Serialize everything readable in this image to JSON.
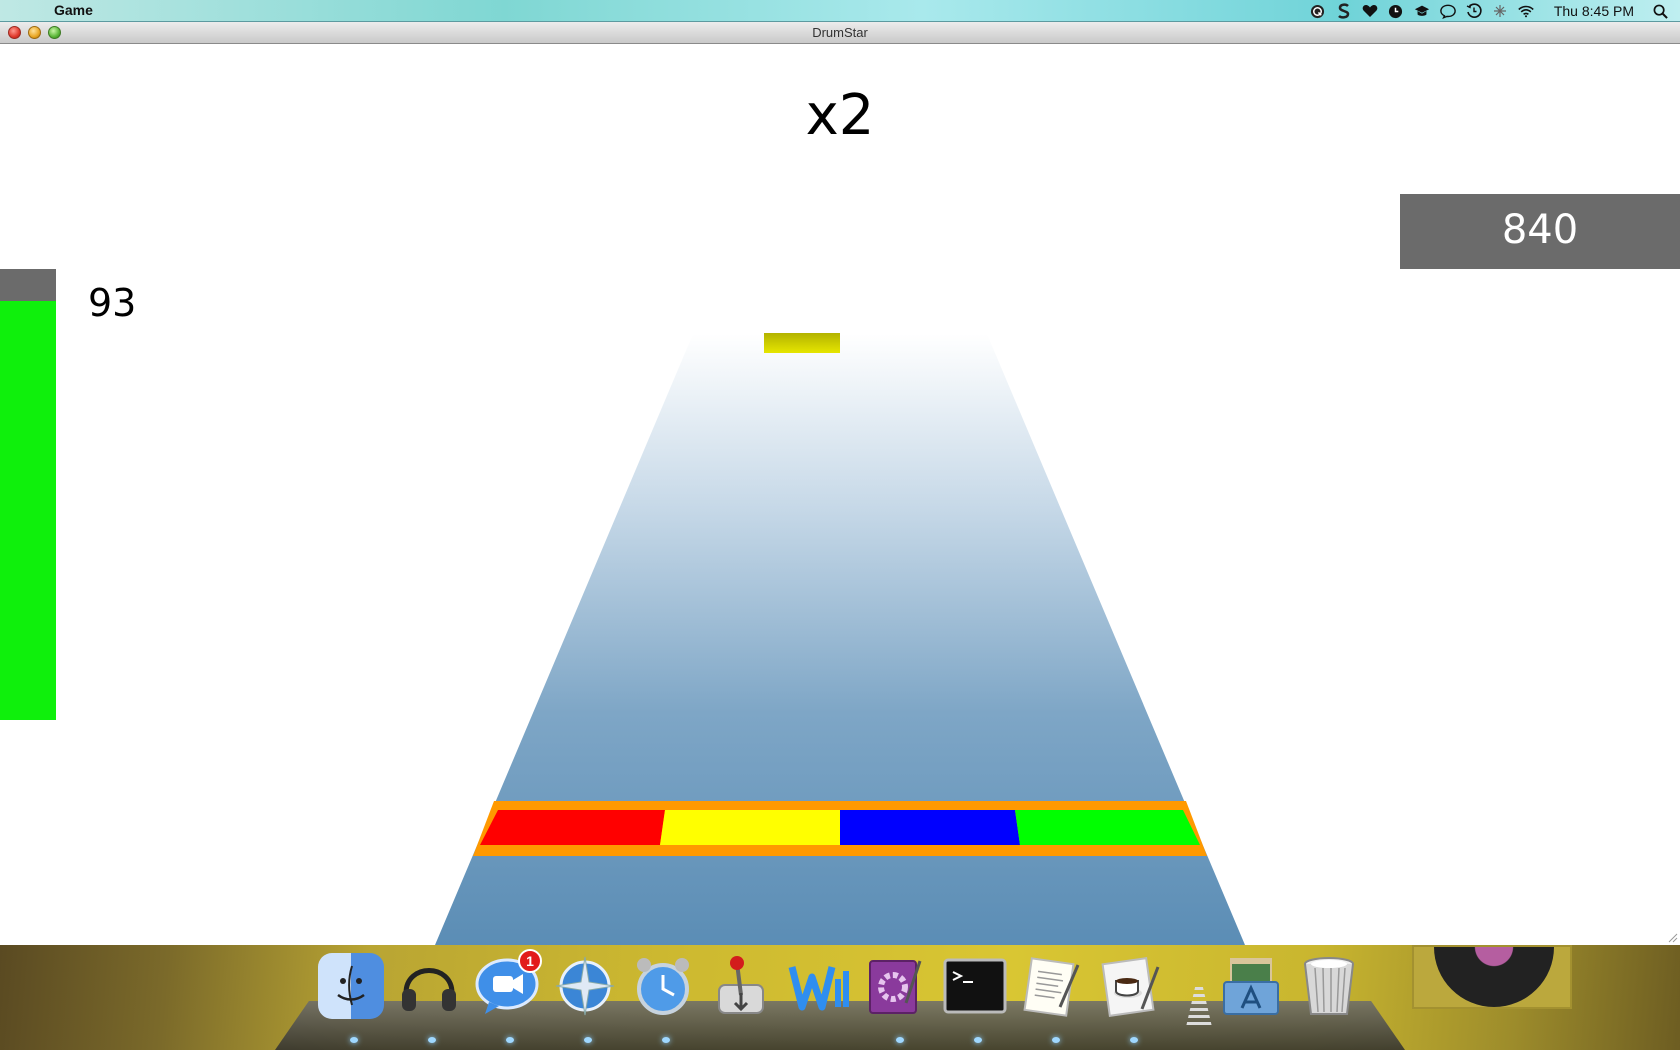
{
  "menubar": {
    "apple_symbol": "",
    "app_name": "Game",
    "status_icons": [
      "q-icon",
      "s-icon",
      "heart-icon",
      "clock-icon",
      "graduation-icon",
      "chat-icon",
      "time-machine-icon",
      "bluetooth-icon",
      "wifi-icon"
    ],
    "clock": "Thu 8:45 PM"
  },
  "window": {
    "title": "DrumStar"
  },
  "game": {
    "multiplier": "x2",
    "score": "840",
    "health_value": "93",
    "health_fraction": 1.0,
    "note_color": "#e6e600",
    "lane_colors": [
      "#ff0000",
      "#ffff00",
      "#0000ff",
      "#00ff00"
    ],
    "hit_bar_border_color": "#ff9900",
    "track_colors": {
      "top": "#ffffff",
      "bottom": "#5b8db5"
    }
  },
  "dock": {
    "apps": [
      {
        "name": "Finder",
        "icon": "finder-icon",
        "badge": ""
      },
      {
        "name": "Headphones",
        "icon": "headphones-icon",
        "badge": ""
      },
      {
        "name": "iChat",
        "icon": "ichat-icon",
        "badge": "1"
      },
      {
        "name": "Safari",
        "icon": "compass-icon",
        "badge": ""
      },
      {
        "name": "Alarm Clock",
        "icon": "alarm-clock-icon",
        "badge": ""
      },
      {
        "name": "Utility",
        "icon": "joystick-icon",
        "badge": ""
      },
      {
        "name": "Word",
        "icon": "word-icon",
        "badge": ""
      },
      {
        "name": "Preferences",
        "icon": "gear-doc-icon",
        "badge": ""
      },
      {
        "name": "Terminal",
        "icon": "terminal-icon",
        "badge": ""
      },
      {
        "name": "TextEdit",
        "icon": "textedit-icon",
        "badge": ""
      },
      {
        "name": "Coffee",
        "icon": "coffee-icon",
        "badge": ""
      },
      {
        "name": "Applications",
        "icon": "applications-stack-icon",
        "badge": ""
      },
      {
        "name": "Trash",
        "icon": "trash-icon",
        "badge": ""
      }
    ]
  }
}
